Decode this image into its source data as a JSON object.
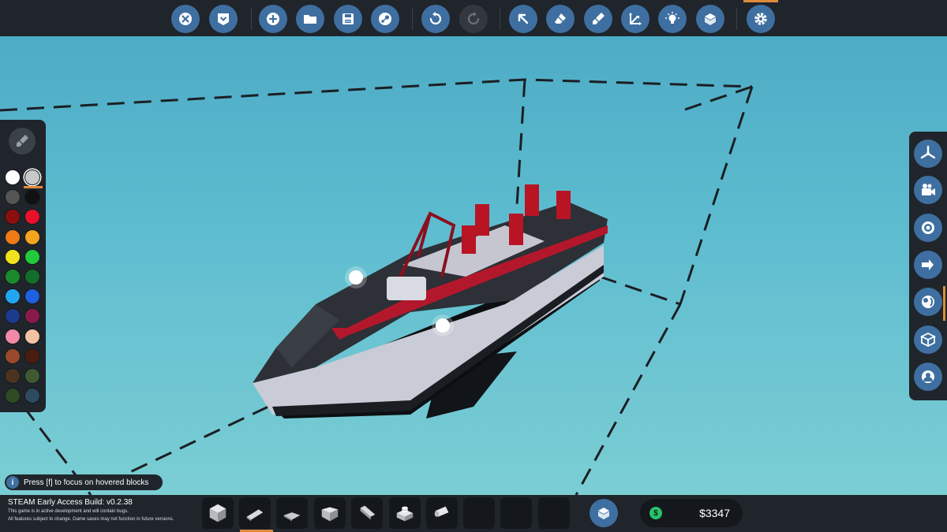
{
  "toolbar": {
    "groups": [
      [
        "close-icon",
        "collapse-icon"
      ],
      [
        "add-icon",
        "folder-icon",
        "save-icon",
        "steam-icon"
      ],
      [
        "undo-icon",
        "redo-icon"
      ],
      [
        "select-icon",
        "eraser-icon",
        "paint-icon",
        "axis-icon",
        "light-icon",
        "block-icon"
      ],
      [
        "settings-icon"
      ]
    ],
    "accent_color": "#3e6fa0",
    "active_indicator_color": "#e08a3b"
  },
  "palette": {
    "colors": [
      "#ffffff",
      "#c8c8c8",
      "#555555",
      "#111111",
      "#8b0f0f",
      "#e8102b",
      "#ee7a18",
      "#f2a51d",
      "#f0e21c",
      "#22c93a",
      "#1a8a2c",
      "#136e2b",
      "#23a6f0",
      "#1f5fe0",
      "#1d3a8c",
      "#8a1a4a",
      "#f08aa6",
      "#f2c2a4",
      "#9a4a2a",
      "#4a1d10",
      "#4a3420",
      "#3f5a30",
      "#2f4a24",
      "#2e4a60"
    ],
    "selected_index": 1
  },
  "right_panel": {
    "items": [
      "propeller-icon",
      "camera-icon",
      "target-icon",
      "transfer-icon",
      "lens-icon",
      "box-icon",
      "avatar-icon"
    ]
  },
  "hint": {
    "icon_text": "i",
    "text": "Press [f] to focus on hovered blocks"
  },
  "build": {
    "title": "STEAM Early Access Build: v0.2.38",
    "line1": "This game is in active development and will contain bugs.",
    "line2": "All features subject to change. Game saves may not function in future versions."
  },
  "inventory": {
    "slots": [
      "cube-block",
      "wedge-block",
      "flat-wedge-block",
      "slope-block",
      "ramp-block",
      "stud-block",
      "pipe-block",
      "",
      "",
      ""
    ]
  },
  "money": {
    "icon": "$",
    "value": "$3347"
  }
}
